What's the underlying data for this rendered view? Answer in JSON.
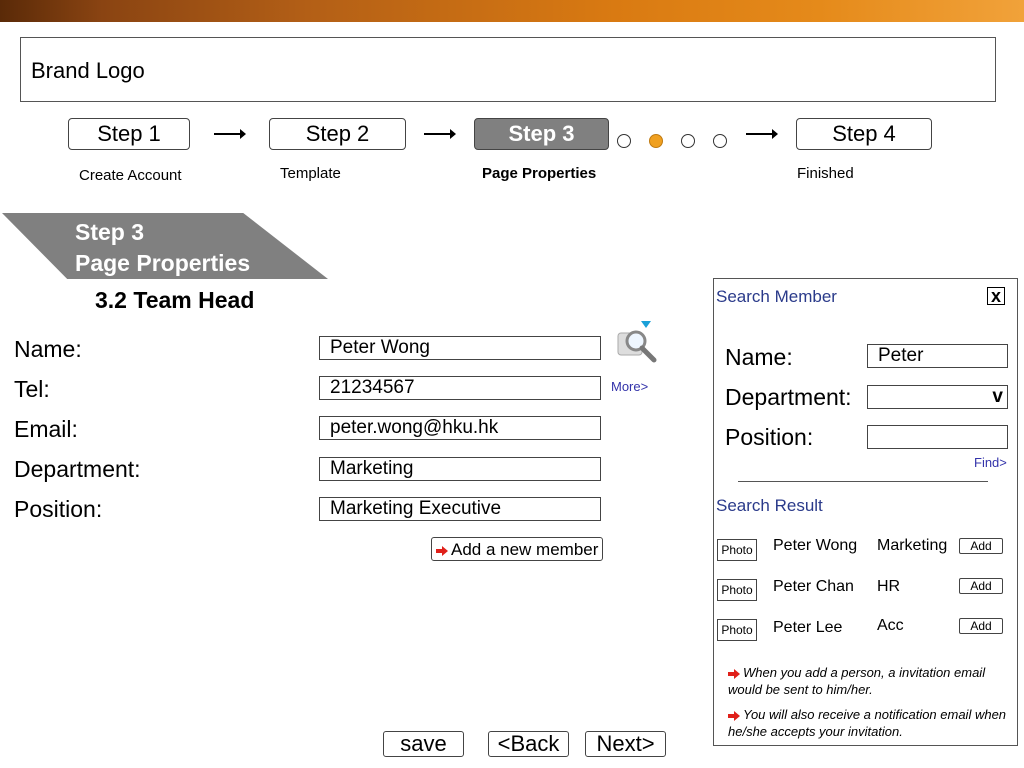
{
  "brand": {
    "logo_text": "Brand Logo"
  },
  "wizard": {
    "steps": [
      {
        "label": "Step 1",
        "caption": "Create Account"
      },
      {
        "label": "Step 2",
        "caption": "Template"
      },
      {
        "label": "Step 3",
        "caption": "Page Properties"
      },
      {
        "label": "Step 4",
        "caption": "Finished"
      }
    ],
    "active_step": 3
  },
  "section": {
    "step": "Step 3",
    "title": "Page Properties",
    "subtitle": "3.2 Team Head"
  },
  "form": {
    "name_label": "Name:",
    "name_value": "Peter Wong",
    "tel_label": "Tel:",
    "tel_value": "21234567",
    "email_label": "Email:",
    "email_value": "peter.wong@hku.hk",
    "department_label": "Department:",
    "department_value": "Marketing",
    "position_label": "Position:",
    "position_value": "Marketing Executive",
    "more_link": "More>",
    "add_member": "Add a new member"
  },
  "search_panel": {
    "title": "Search Member",
    "close": "x",
    "name_label": "Name:",
    "name_value": "Peter",
    "department_label": "Department:",
    "department_value": "",
    "dropdown_glyph": "v",
    "position_label": "Position:",
    "position_value": "",
    "find_link": "Find>",
    "result_title": "Search Result",
    "results": [
      {
        "photo": "Photo",
        "name": "Peter Wong",
        "dept": "Marketing",
        "action": "Add"
      },
      {
        "photo": "Photo",
        "name": "Peter Chan",
        "dept": "HR",
        "action": "Add"
      },
      {
        "photo": "Photo",
        "name": "Peter Lee",
        "dept": "Acc",
        "action": "Add"
      }
    ],
    "notes": [
      "When you add a person, a invitation email would be sent to him/her.",
      "You will also receive a notification email when he/she accepts your invitation."
    ]
  },
  "footer": {
    "save": "save",
    "back": "<Back",
    "next": "Next>"
  },
  "colors": {
    "accent": "#e58a1a",
    "step_active_bg": "#808080",
    "link": "#3333aa",
    "note_arrow": "#e0201a"
  }
}
